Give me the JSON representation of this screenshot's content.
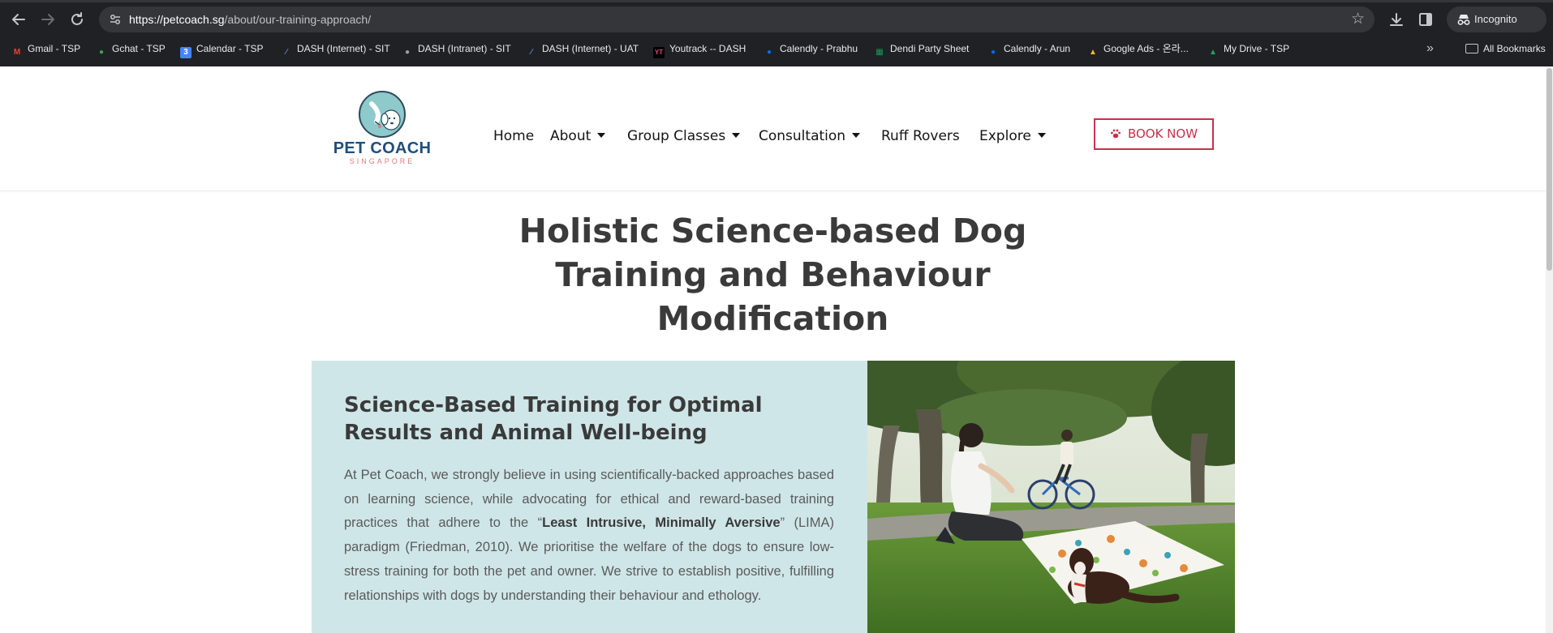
{
  "browser": {
    "url_host": "https://petcoach.sg",
    "url_path": "/about/our-training-approach/",
    "incognito_label": "Incognito",
    "bookmarks": [
      {
        "label": "Gmail - TSP",
        "icon": "gmail-icon",
        "color": "#ea4335"
      },
      {
        "label": "Gchat - TSP",
        "icon": "gchat-icon",
        "color": "#34a853"
      },
      {
        "label": "Calendar - TSP",
        "icon": "calendar-icon",
        "color": "#4285f4"
      },
      {
        "label": "DASH (Internet) - SIT",
        "icon": "dash-icon",
        "color": "#5b8def"
      },
      {
        "label": "DASH (Intranet) - SIT",
        "icon": "globe-icon",
        "color": "#9aa0a6"
      },
      {
        "label": "DASH (Internet) - UAT",
        "icon": "dash-icon",
        "color": "#5b8def"
      },
      {
        "label": "Youtrack -- DASH",
        "icon": "youtrack-icon",
        "color": "#e8467c"
      },
      {
        "label": "Calendly - Prabhu",
        "icon": "calendly-icon",
        "color": "#006bff"
      },
      {
        "label": "Dendi Party Sheet",
        "icon": "sheets-icon",
        "color": "#0f9d58"
      },
      {
        "label": "Calendly - Arun",
        "icon": "calendly-icon",
        "color": "#006bff"
      },
      {
        "label": "Google Ads - 온라...",
        "icon": "google-ads-icon",
        "color": "#fbbc04"
      },
      {
        "label": "My Drive - TSP",
        "icon": "drive-icon",
        "color": "#1fa463"
      }
    ],
    "all_bookmarks_label": "All Bookmarks"
  },
  "site": {
    "logo_name": "PET COACH",
    "logo_sub": "SINGAPORE",
    "nav": [
      {
        "label": "Home",
        "dropdown": false
      },
      {
        "label": "About",
        "dropdown": true
      },
      {
        "label": "Group Classes",
        "dropdown": true
      },
      {
        "label": "Consultation",
        "dropdown": true
      },
      {
        "label": "Ruff Rovers",
        "dropdown": false
      },
      {
        "label": "Explore",
        "dropdown": true
      }
    ],
    "book_now_label": "BOOK NOW",
    "accent_color": "#c8304a"
  },
  "main": {
    "title_line1": "Holistic Science-based Dog",
    "title_line2": "Training and Behaviour",
    "title_line3": "Modification",
    "panel": {
      "heading_line1": "Science-Based Training for Optimal",
      "heading_line2": "Results and Animal Well-being",
      "para_part1": "At Pet Coach, we strongly believe in using scientifically-backed approaches based on learning science, while advocating for ethical and reward-based training practices that adhere to the “",
      "para_bold": "Least Intrusive, Minimally Aversive",
      "para_part2": "” (LIMA) paradigm (Friedman, 2010). We prioritise the welfare of the dogs to ensure low-stress training for both the pet and owner. We strive to establish positive, fulfilling relationships with dogs by understanding their behaviour and ethology.",
      "background_color": "#cfe6e8"
    }
  }
}
